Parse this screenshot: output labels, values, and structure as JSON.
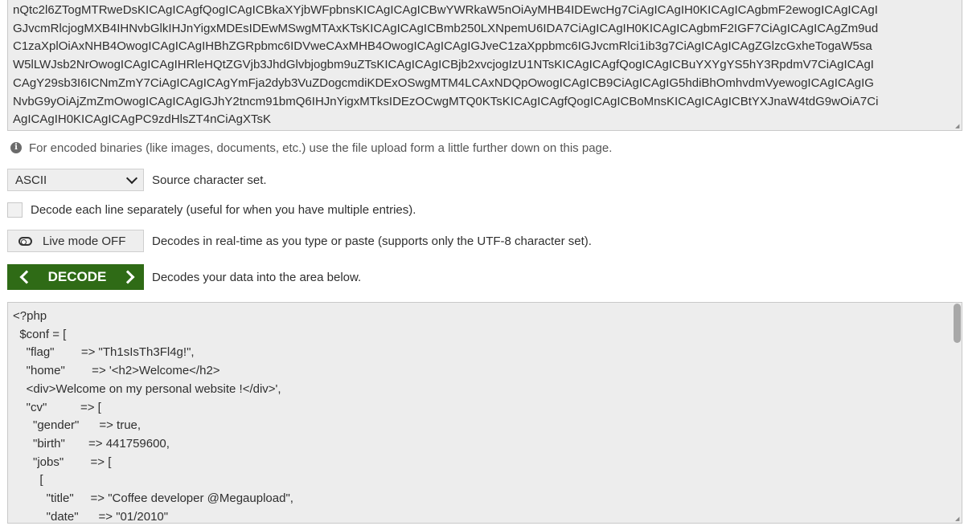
{
  "input": {
    "lines": [
      "nQtc2l6ZTogMTRweDsKICAgICAgfQogICAgICBkaXYjbWFpbnsKICAgICAgICBwYWRkaW5nOiAyMHB4IDEwcHg7CiAgICAgIH0KICAgICAgbmF2ewogICAgICAgI",
      "GJvcmRlcjogMXB4IHNvbGlkIHJnYigxMDEsIDEwMSwgMTAxKTsKICAgICAgICBmb250LXNpemU6IDA7CiAgICAgIH0KICAgICAgbmF2IGF7CiAgICAgICAgZm9ud",
      "C1zaXplOiAxNHB4OwogICAgICAgIHBhZGRpbmc6IDVweCAxMHB4OwogICAgICAgIGJveC1zaXppbmc6IGJvcmRlci1ib3g7CiAgICAgICAgZGlzcGxheTogaW5sa",
      "W5lLWJsb2NrOwogICAgICAgIHRleHQtZGVjb3JhdGlvbjogbm9uZTsKICAgICAgICBjb2xvcjogIzU1NTsKICAgICAgfQogICAgICBuYXYgYS5hY3RpdmV7CiAgICAgI",
      "CAgY29sb3I6ICNmZmY7CiAgICAgICAgYmFja2dyb3VuZDogcmdiKDExOSwgMTM4LCAxNDQpOwogICAgICB9CiAgICAgIG5hdiBhOmhvdmVyewogICAgICAgIG",
      "NvbG9yOiAjZmZmOwogICAgICAgIGJhY2tncm91bmQ6IHJnYigxMTksIDEzOCwgMTQ0KTsKICAgICAgfQogICAgICBoMnsKICAgICAgICBtYXJnaW4tdG9wOiA7Ci",
      "AgICAgIH0KICAgICAgPC9zdHlsZT4nCiAgXTsK"
    ]
  },
  "info": {
    "text": "For encoded binaries (like images, documents, etc.) use the file upload form a little further down on this page."
  },
  "charset": {
    "selected": "ASCII",
    "label": "Source character set."
  },
  "decode_lines": {
    "label": "Decode each line separately (useful for when you have multiple entries)."
  },
  "live_mode": {
    "button_label": "Live mode OFF",
    "description": "Decodes in real-time as you type or paste (supports only the UTF-8 character set)."
  },
  "decode": {
    "button_label": "DECODE",
    "description": "Decodes your data into the area below."
  },
  "output": {
    "lines": [
      "<?php",
      "  $conf = [",
      "    \"flag\"        => \"Th1sIsTh3Fl4g!\",",
      "    \"home\"        => '<h2>Welcome</h2>",
      "    <div>Welcome on my personal website !</div>',",
      "    \"cv\"          => [",
      "      \"gender\"      => true,",
      "      \"birth\"       => 441759600,",
      "      \"jobs\"        => [",
      "        [",
      "          \"title\"     => \"Coffee developer @Megaupload\",",
      "          \"date\"      => \"01/2010\""
    ]
  }
}
